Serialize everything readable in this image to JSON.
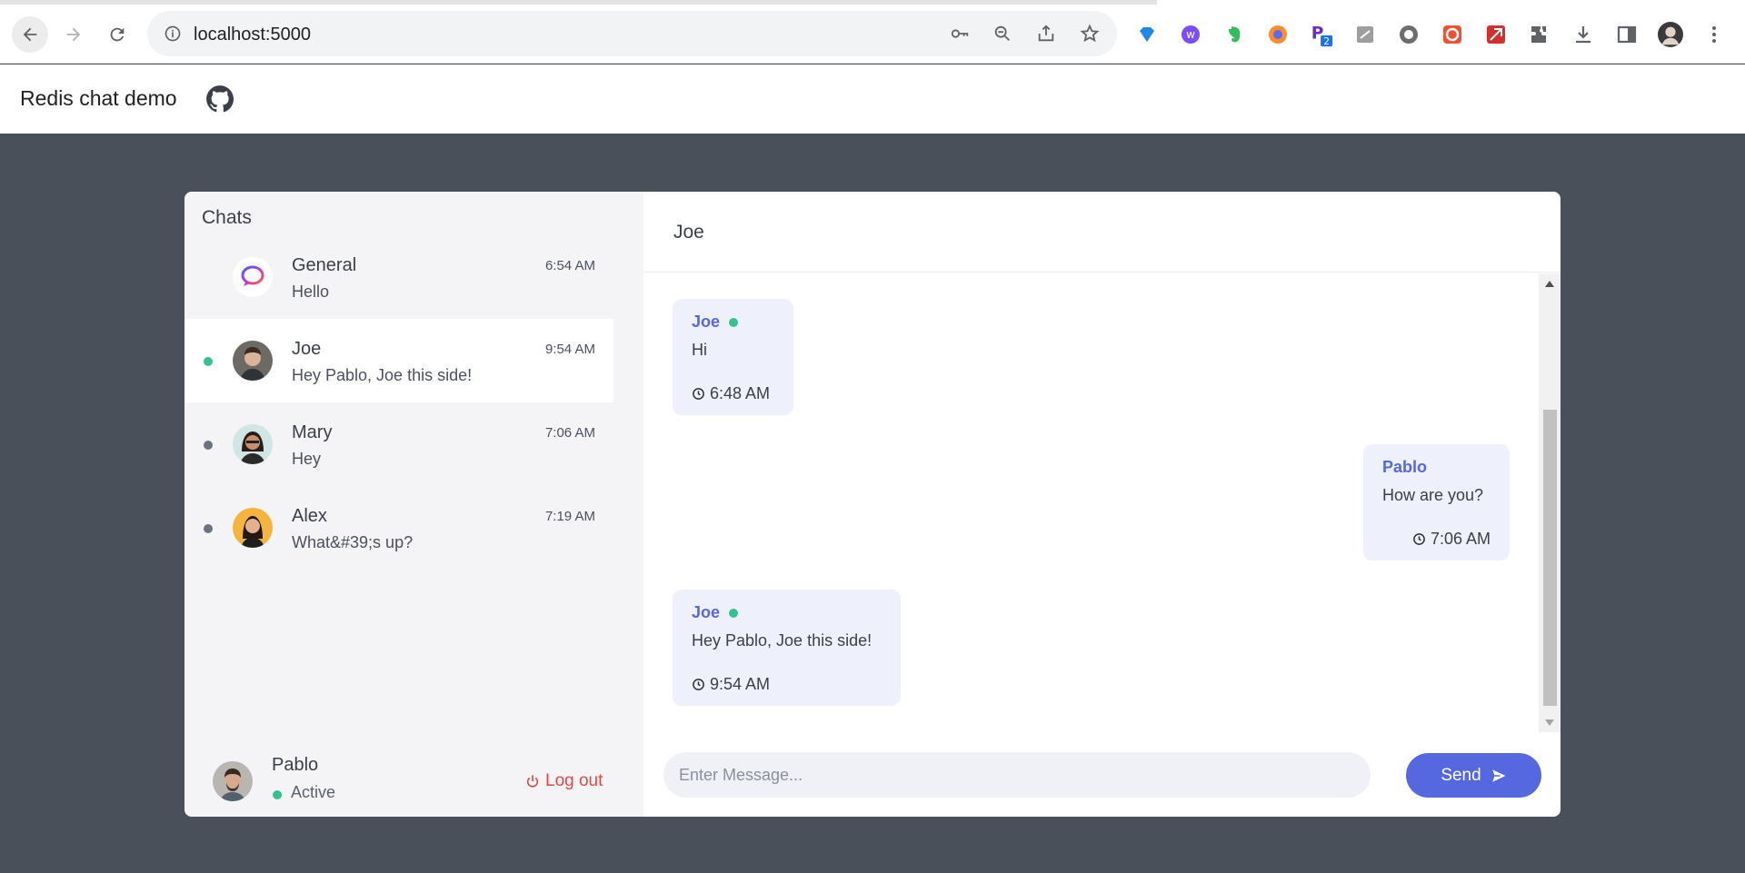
{
  "browser": {
    "url": "localhost:5000",
    "extension_badge": "2"
  },
  "app": {
    "title": "Redis chat demo"
  },
  "sidebar": {
    "title": "Chats",
    "chats": [
      {
        "name": "General",
        "preview": "Hello",
        "time": "6:54 AM",
        "online": false,
        "active": false
      },
      {
        "name": "Joe",
        "preview": "Hey Pablo, Joe this side!",
        "time": "9:54 AM",
        "online": true,
        "active": true
      },
      {
        "name": "Mary",
        "preview": "Hey",
        "time": "7:06 AM",
        "online": false,
        "active": false
      },
      {
        "name": "Alex",
        "preview": "What&#39;s up?",
        "time": "7:19 AM",
        "online": false,
        "active": false
      }
    ],
    "current_user": {
      "name": "Pablo",
      "status": "Active"
    },
    "logout_label": "Log out"
  },
  "conversation": {
    "title": "Joe",
    "messages": [
      {
        "sender": "Joe",
        "text": "Hi",
        "time": "6:48 AM",
        "online": true,
        "side": "left"
      },
      {
        "sender": "Pablo",
        "text": "How are you?",
        "time": "7:06 AM",
        "online": false,
        "side": "right"
      },
      {
        "sender": "Joe",
        "text": "Hey Pablo, Joe this side!",
        "time": "9:54 AM",
        "online": true,
        "side": "left"
      }
    ],
    "composer_placeholder": "Enter Message...",
    "send_label": "Send"
  },
  "colors": {
    "accent": "#5668e0",
    "online": "#34c38f",
    "offline": "#6b7280",
    "logout": "#e04848",
    "background": "#4a5059"
  }
}
